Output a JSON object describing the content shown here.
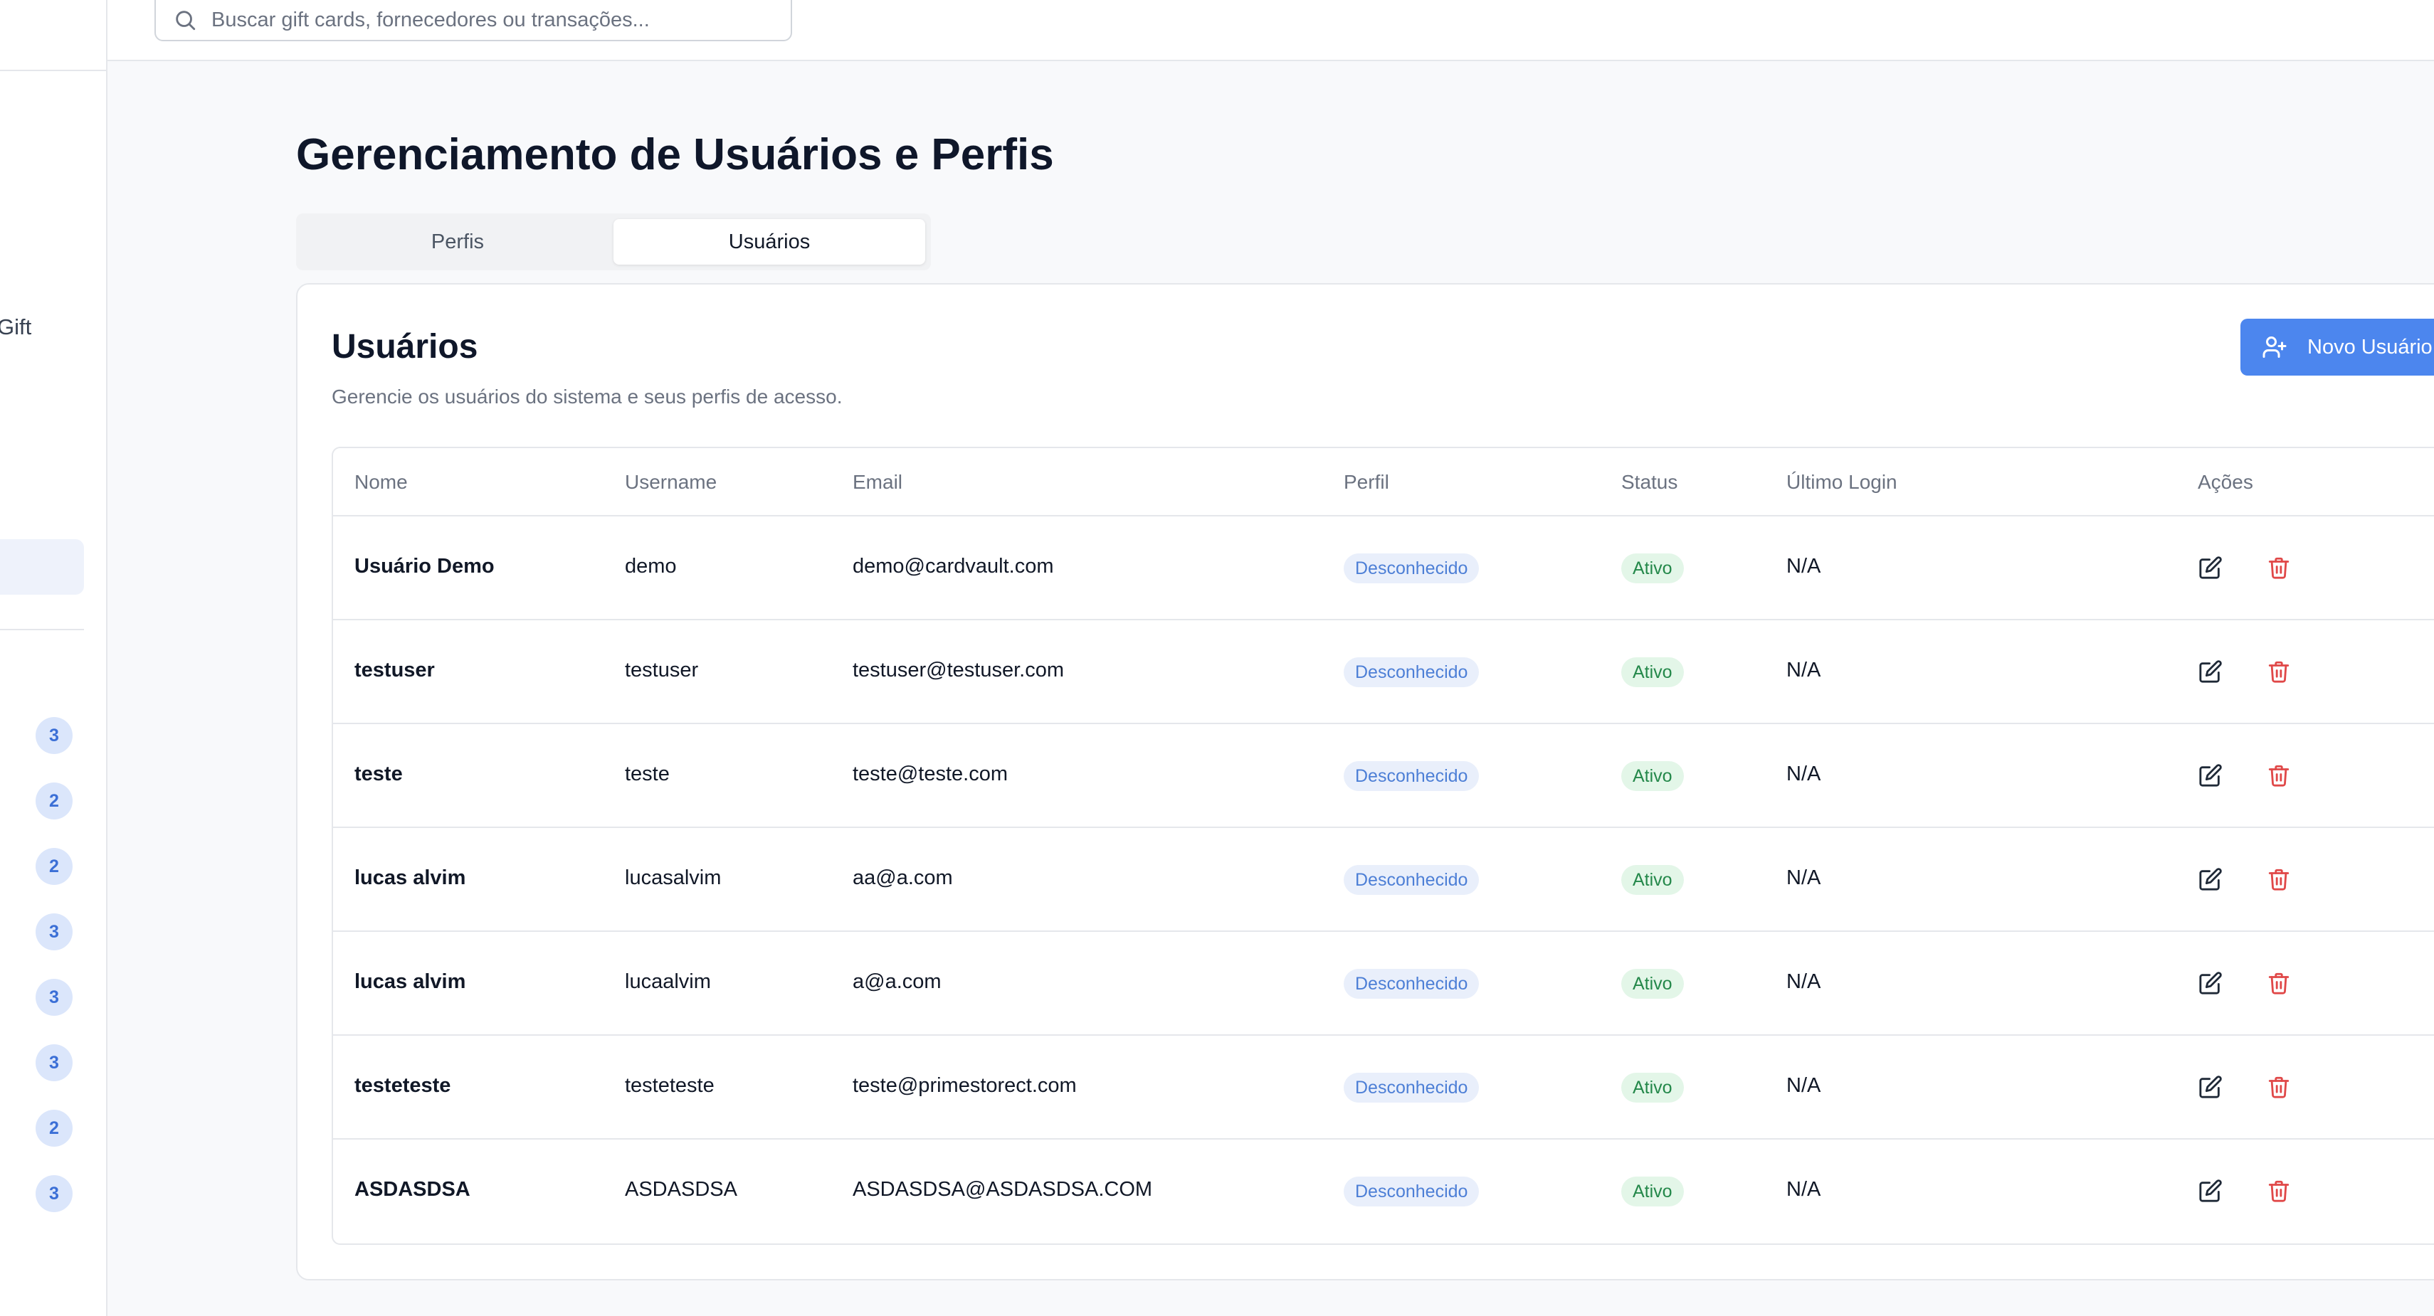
{
  "sidebar": {
    "partial_label": "Gift",
    "badges": [
      "3",
      "2",
      "2",
      "3",
      "3",
      "3",
      "2",
      "3"
    ]
  },
  "header": {
    "search": {
      "placeholder": "Buscar gift cards, fornecedores ou transações...",
      "value": ""
    }
  },
  "main": {
    "title": "Gerenciamento de Usuários e Perfis",
    "tabs": [
      {
        "label": "Perfis",
        "active": false
      },
      {
        "label": "Usuários",
        "active": true
      }
    ],
    "card": {
      "title": "Usuários",
      "description": "Gerencie os usuários do sistema e seus perfis de acesso.",
      "new_button_label": "Novo Usuário",
      "columns": [
        "Nome",
        "Username",
        "Email",
        "Perfil",
        "Status",
        "Último Login",
        "Ações"
      ],
      "rows": [
        {
          "nome": "Usuário Demo",
          "username": "demo",
          "email": "demo@cardvault.com",
          "perfil": "Desconhecido",
          "status": "Ativo",
          "ultimo_login": "N/A"
        },
        {
          "nome": "testuser",
          "username": "testuser",
          "email": "testuser@testuser.com",
          "perfil": "Desconhecido",
          "status": "Ativo",
          "ultimo_login": "N/A"
        },
        {
          "nome": "teste",
          "username": "teste",
          "email": "teste@teste.com",
          "perfil": "Desconhecido",
          "status": "Ativo",
          "ultimo_login": "N/A"
        },
        {
          "nome": "lucas alvim",
          "username": "lucasalvim",
          "email": "aa@a.com",
          "perfil": "Desconhecido",
          "status": "Ativo",
          "ultimo_login": "N/A"
        },
        {
          "nome": "lucas alvim",
          "username": "lucaalvim",
          "email": "a@a.com",
          "perfil": "Desconhecido",
          "status": "Ativo",
          "ultimo_login": "N/A"
        },
        {
          "nome": "testeteste",
          "username": "testeteste",
          "email": "teste@primestorect.com",
          "perfil": "Desconhecido",
          "status": "Ativo",
          "ultimo_login": "N/A"
        },
        {
          "nome": "ASDASDSA",
          "username": "ASDASDSA",
          "email": "ASDASDSA@ASDASDSA.COM",
          "perfil": "Desconhecido",
          "status": "Ativo",
          "ultimo_login": "N/A"
        }
      ]
    }
  },
  "colors": {
    "primary": "#4c86ee",
    "badge_bg": "#dbe6fb",
    "status_active": "#24884a",
    "danger": "#e04848"
  },
  "icons": [
    "search-icon",
    "user-plus-icon",
    "edit-icon",
    "trash-icon"
  ]
}
